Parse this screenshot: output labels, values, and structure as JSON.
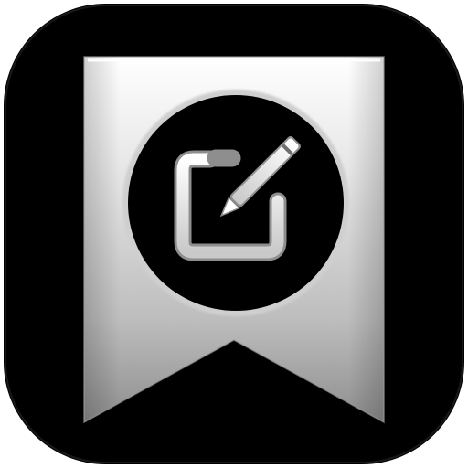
{
  "app_icon": {
    "name": "bookmark-edit",
    "tile_color": "#000000",
    "ribbon_gradient": [
      "#ffffff",
      "#e7e7e7",
      "#bdbdbd",
      "#8e8e8e"
    ],
    "badge_color": "#000000",
    "glyph": "compose-icon"
  }
}
